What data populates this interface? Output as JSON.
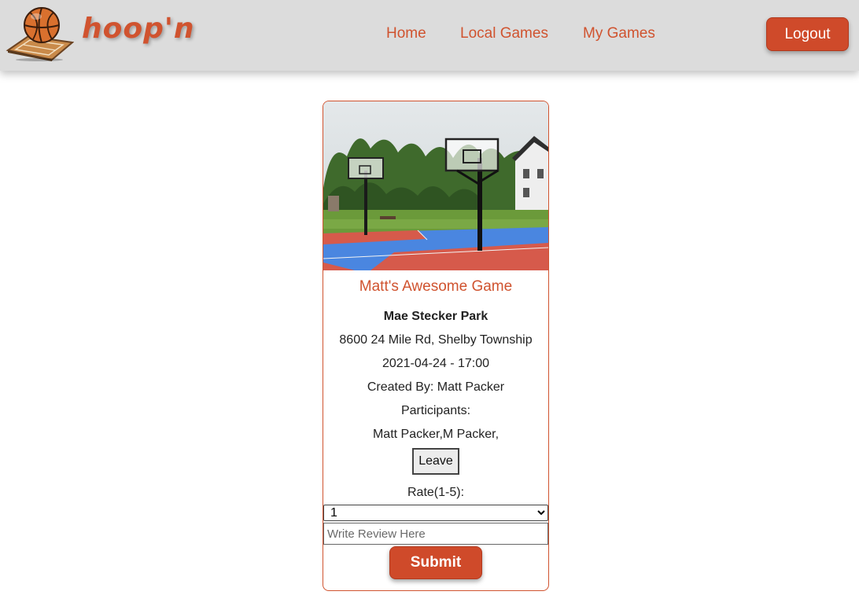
{
  "header": {
    "brand": "hoop'n",
    "nav": {
      "home": "Home",
      "local_games": "Local Games",
      "my_games": "My Games"
    },
    "logout_label": "Logout"
  },
  "game": {
    "title": "Matt's Awesome Game",
    "park": "Mae Stecker Park",
    "address": "8600 24 Mile Rd, Shelby Township",
    "datetime": "2021-04-24 - 17:00",
    "created_by": "Created By: Matt Packer",
    "participants_label": "Participants:",
    "participants": "Matt Packer,M Packer,",
    "leave_label": "Leave"
  },
  "review_form": {
    "rate_label": "Rate(1-5):",
    "rate_selected": "1",
    "review_placeholder": "Write Review Here",
    "submit_label": "Submit"
  },
  "colors": {
    "accent": "#d0532f",
    "header_bg": "#dcdcdc"
  },
  "icons": {
    "logo": "basketball-court-logo-icon",
    "photo": "basketball-court-photo"
  }
}
